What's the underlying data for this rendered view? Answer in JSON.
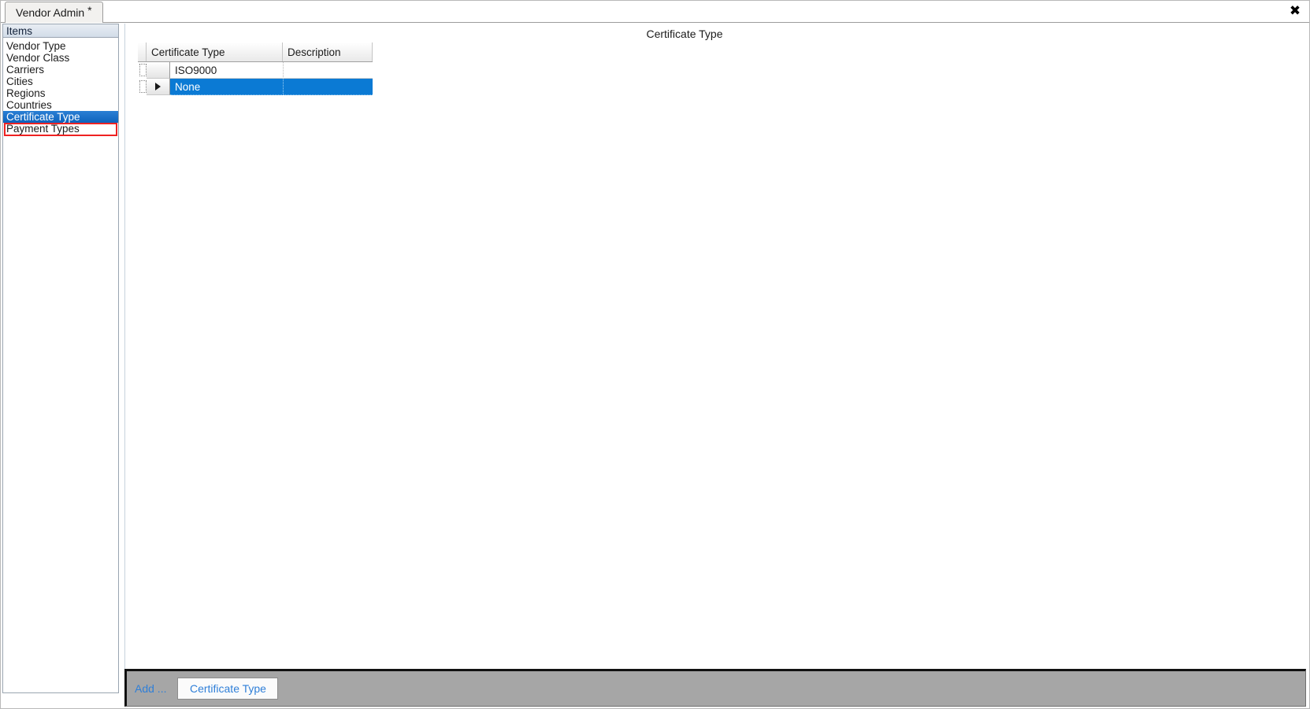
{
  "window": {
    "tab_label": "Vendor Admin",
    "tab_dirty_marker": "*",
    "close_icon": "close-icon",
    "close_glyph": "✖"
  },
  "sidebar": {
    "header": "Items",
    "selected_index": 6,
    "items": [
      {
        "label": "Vendor Type"
      },
      {
        "label": "Vendor Class"
      },
      {
        "label": "Carriers"
      },
      {
        "label": "Cities"
      },
      {
        "label": "Regions"
      },
      {
        "label": "Countries"
      },
      {
        "label": "Certificate Type"
      },
      {
        "label": "Payment Types"
      }
    ]
  },
  "main": {
    "title": "Certificate Type",
    "grid": {
      "columns": [
        "Certificate Type",
        "Description"
      ],
      "rows": [
        {
          "certificate_type": "ISO9000",
          "description": "",
          "selected": false,
          "indicator": ""
        },
        {
          "certificate_type": "None",
          "description": "",
          "selected": true,
          "indicator": "▶"
        }
      ]
    }
  },
  "toolbar": {
    "add_label": "Add ...",
    "add_button_label": "Certificate Type"
  },
  "colors": {
    "selection_blue": "#0b7ad4",
    "sidebar_selection_blue": "#1a6fc6",
    "annotation_red": "#ee2222",
    "link_blue": "#2f7fd8",
    "toolbar_gray": "#a6a6a6"
  }
}
